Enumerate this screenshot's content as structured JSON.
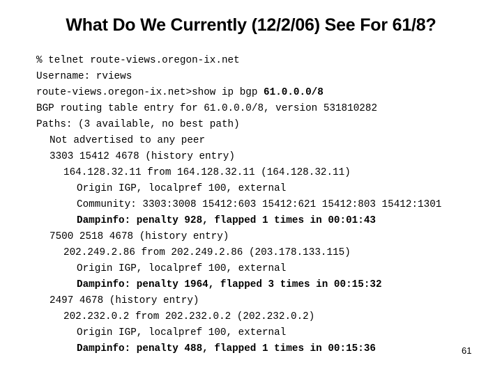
{
  "slide": {
    "title": "What Do We Currently (12/2/06) See For 61/8?",
    "page_number": "61"
  },
  "terminal": {
    "telnet_cmd": "% telnet route-views.oregon-ix.net",
    "username": "Username: rviews",
    "prompt": "route-views.oregon-ix.net>show ip bgp ",
    "prompt_arg": "61.0.0.0/8",
    "entry_header": "BGP routing table entry for 61.0.0.0/8, version 531810282",
    "paths_summary": "Paths: (3 available, no best path)",
    "not_advertised": "Not advertised to any peer",
    "paths": [
      {
        "as_path": "3303 15412 4678 (history entry)",
        "neighbor": "164.128.32.11 from 164.128.32.11 (164.128.32.11)",
        "origin": "Origin IGP, localpref 100, external",
        "community": "Community: 3303:3008 15412:603 15412:621 15412:803 15412:1301",
        "dampinfo": "Dampinfo: penalty 928, flapped 1 times in 00:01:43"
      },
      {
        "as_path": "7500 2518 4678 (history entry)",
        "neighbor": "202.249.2.86 from 202.249.2.86 (203.178.133.115)",
        "origin": "Origin IGP, localpref 100, external",
        "dampinfo": "Dampinfo: penalty 1964, flapped 3 times in 00:15:32"
      },
      {
        "as_path": "2497 4678 (history entry)",
        "neighbor": "202.232.0.2 from 202.232.0.2 (202.232.0.2)",
        "origin": "Origin IGP, localpref 100, external",
        "dampinfo": "Dampinfo: penalty 488, flapped 1 times in 00:15:36"
      }
    ]
  }
}
